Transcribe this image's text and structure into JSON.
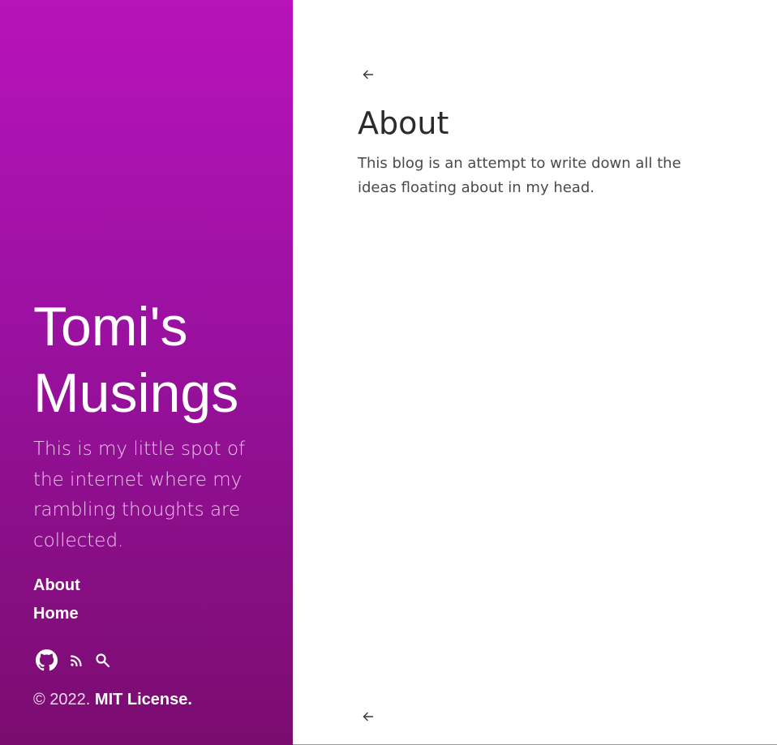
{
  "sidebar": {
    "title": "Tomi's Musings",
    "tagline": "This is my little spot of the internet where my rambling thoughts are collected.",
    "nav": [
      {
        "label": "About"
      },
      {
        "label": "Home"
      }
    ],
    "icons": [
      "github-icon",
      "rss-icon",
      "search-icon"
    ],
    "copyright_prefix": "© 2022.",
    "copyright_license": "MIT License."
  },
  "main": {
    "back_icon": "arrow-left-icon",
    "title": "About",
    "body": "This blog is an attempt to write down all the ideas floating about in my head."
  },
  "colors": {
    "sidebar_top": "#b812bb",
    "sidebar_bottom": "#7a0c6f",
    "heading": "#2b2b2b",
    "body_text": "#4a4a4a"
  }
}
